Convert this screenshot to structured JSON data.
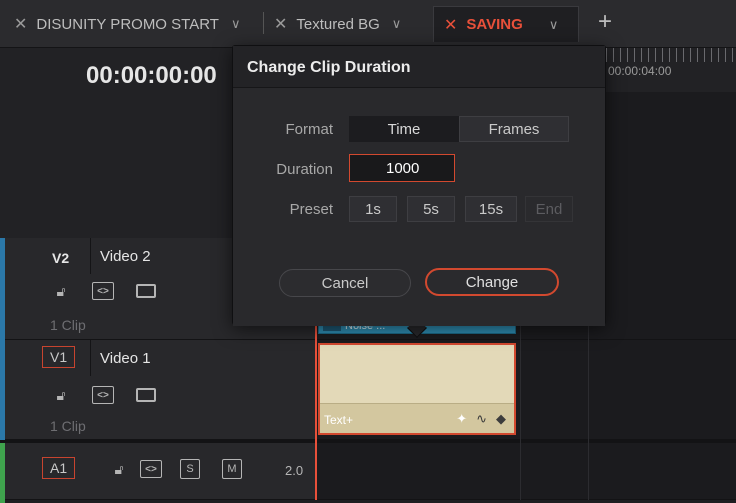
{
  "tabs": [
    {
      "label": "DISUNITY PROMO START",
      "active": false
    },
    {
      "label": "Textured BG",
      "active": false
    },
    {
      "label": "SAVING",
      "active": true
    }
  ],
  "timecode": "00:00:00:00",
  "ruler_time": "00:00:04:00",
  "tracks": {
    "v2": {
      "id": "V2",
      "name": "Video 2",
      "clip_count": "1 Clip",
      "clip_name": "Noise ..."
    },
    "v1": {
      "id": "V1",
      "name": "Video 1",
      "clip_count": "1 Clip",
      "clip_name": "Text+"
    },
    "a1": {
      "id": "A1",
      "s": "S",
      "m": "M",
      "value": "2.0"
    }
  },
  "dialog": {
    "title": "Change Clip Duration",
    "format_label": "Format",
    "format_options": [
      "Time",
      "Frames"
    ],
    "format_selected": "Time",
    "duration_label": "Duration",
    "duration_value": "1000",
    "preset_label": "Preset",
    "presets": [
      "1s",
      "5s",
      "15s",
      "End"
    ],
    "cancel_label": "Cancel",
    "change_label": "Change"
  },
  "colors": {
    "accent": "#d2492f",
    "video_track": "#2b78a8",
    "audio_track": "#3fa34d"
  }
}
